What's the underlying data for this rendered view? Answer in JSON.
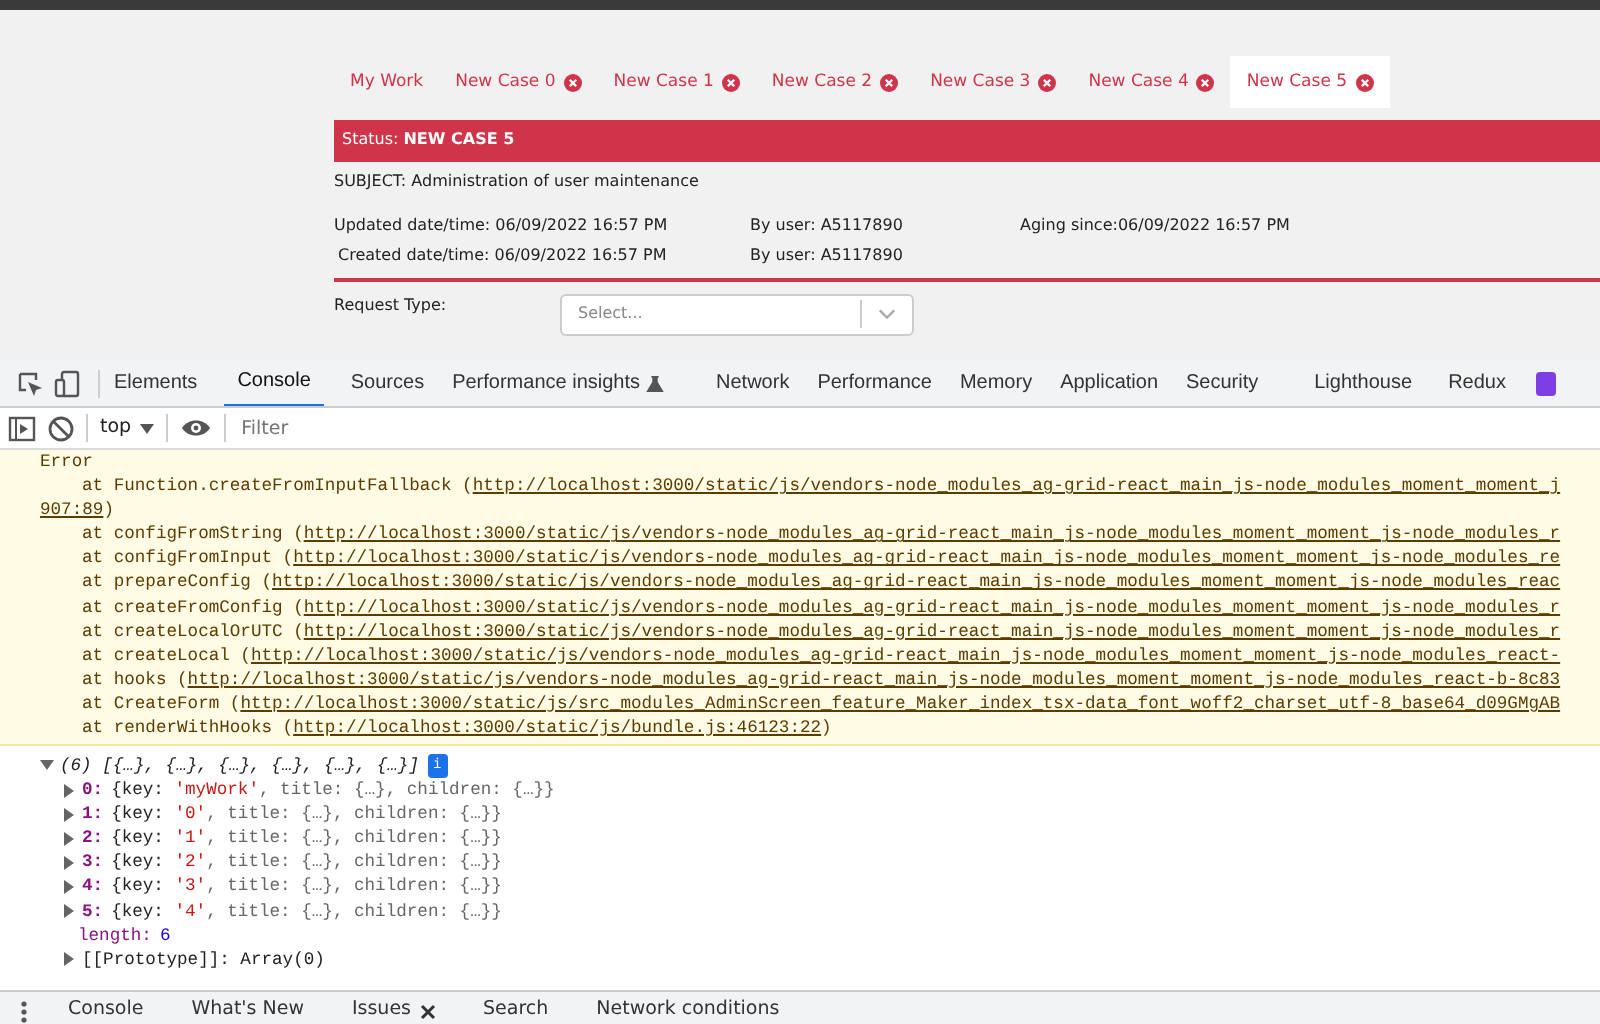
{
  "app": {
    "tabs": [
      {
        "label": "My Work",
        "closable": false,
        "selected": false
      },
      {
        "label": "New Case 0",
        "closable": true,
        "selected": false
      },
      {
        "label": "New Case 1",
        "closable": true,
        "selected": false
      },
      {
        "label": "New Case 2",
        "closable": true,
        "selected": false
      },
      {
        "label": "New Case 3",
        "closable": true,
        "selected": false
      },
      {
        "label": "New Case 4",
        "closable": true,
        "selected": false
      },
      {
        "label": "New Case 5",
        "closable": true,
        "selected": true
      }
    ],
    "status_label": "Status:",
    "status_value": "NEW CASE 5",
    "subject": "SUBJECT: Administration of user maintenance",
    "info_rows": [
      [
        "Updated date/time: 06/09/2022 16:57 PM",
        "By user: A5117890",
        "Aging since:06/09/2022 16:57 PM"
      ],
      [
        "Created date/time: 06/09/2022 16:57 PM",
        "By user: A5117890"
      ]
    ],
    "request_type_label": "Request Type:",
    "request_type_placeholder": "Select..."
  },
  "devtools": {
    "tabs": [
      {
        "label": "Elements",
        "selected": false,
        "experimental": false
      },
      {
        "label": "Console",
        "selected": true,
        "experimental": false
      },
      {
        "label": "Sources",
        "selected": false,
        "experimental": false
      },
      {
        "label": "Performance insights",
        "selected": false,
        "experimental": true
      },
      {
        "label": "Network",
        "selected": false,
        "experimental": false
      },
      {
        "label": "Performance",
        "selected": false,
        "experimental": false
      },
      {
        "label": "Memory",
        "selected": false,
        "experimental": false
      },
      {
        "label": "Application",
        "selected": false,
        "experimental": false
      },
      {
        "label": "Security",
        "selected": false,
        "experimental": false
      },
      {
        "label": "Lighthouse",
        "selected": false,
        "experimental": false
      },
      {
        "label": "Redux",
        "selected": false,
        "experimental": false
      }
    ],
    "context": "top",
    "filter_placeholder": "Filter",
    "error": {
      "title": "Error",
      "stack": [
        {
          "prefix": "at Function.createFromInputFallback (",
          "link": "http://localhost:3000/static/js/vendors-node_modules_ag-grid-react_main_js-node_modules_moment_moment_j",
          "link_cont": "907:89",
          "suffix": ")"
        },
        {
          "prefix": "at configFromString (",
          "link": "http://localhost:3000/static/js/vendors-node_modules_ag-grid-react_main_js-node_modules_moment_moment_js-node_modules_r"
        },
        {
          "prefix": "at configFromInput (",
          "link": "http://localhost:3000/static/js/vendors-node_modules_ag-grid-react_main_js-node_modules_moment_moment_js-node_modules_re"
        },
        {
          "prefix": "at prepareConfig (",
          "link": "http://localhost:3000/static/js/vendors-node_modules_ag-grid-react_main_js-node_modules_moment_moment_js-node_modules_reac"
        },
        {
          "prefix": "at createFromConfig (",
          "link": "http://localhost:3000/static/js/vendors-node_modules_ag-grid-react_main_js-node_modules_moment_moment_js-node_modules_r"
        },
        {
          "prefix": "at createLocalOrUTC (",
          "link": "http://localhost:3000/static/js/vendors-node_modules_ag-grid-react_main_js-node_modules_moment_moment_js-node_modules_r"
        },
        {
          "prefix": "at createLocal (",
          "link": "http://localhost:3000/static/js/vendors-node_modules_ag-grid-react_main_js-node_modules_moment_moment_js-node_modules_react-"
        },
        {
          "prefix": "at hooks (",
          "link": "http://localhost:3000/static/js/vendors-node_modules_ag-grid-react_main_js-node_modules_moment_moment_js-node_modules_react-b-8c83"
        },
        {
          "prefix": "at CreateForm (",
          "link": "http://localhost:3000/static/js/src_modules_AdminScreen_feature_Maker_index_tsx-data_font_woff2_charset_utf-8_base64_d09GMgAB"
        },
        {
          "prefix": "at renderWithHooks (",
          "link": "http://localhost:3000/static/js/bundle.js:46123:22",
          "suffix": ")"
        }
      ]
    },
    "array": {
      "summary": "(6) [{…}, {…}, {…}, {…}, {…}, {…}]",
      "badge": "i",
      "expanded": true,
      "items": [
        {
          "index": "0:",
          "pre": "{key: ",
          "str": "'myWork'",
          "post": ", title: {…}, children: {…}}"
        },
        {
          "index": "1:",
          "pre": "{key: ",
          "str": "'0'",
          "post": ", title: {…}, children: {…}}"
        },
        {
          "index": "2:",
          "pre": "{key: ",
          "str": "'1'",
          "post": ", title: {…}, children: {…}}"
        },
        {
          "index": "3:",
          "pre": "{key: ",
          "str": "'2'",
          "post": ", title: {…}, children: {…}}"
        },
        {
          "index": "4:",
          "pre": "{key: ",
          "str": "'3'",
          "post": ", title: {…}, children: {…}}"
        },
        {
          "index": "5:",
          "pre": "{key: ",
          "str": "'4'",
          "post": ", title: {…}, children: {…}}"
        }
      ],
      "length_label": "length:",
      "length_value": "6",
      "prototype": "[[Prototype]]: Array(0)"
    },
    "drawer_tabs": [
      {
        "label": "Console",
        "closable": false,
        "selected": false
      },
      {
        "label": "What's New",
        "closable": false,
        "selected": false
      },
      {
        "label": "Issues",
        "closable": true,
        "selected": false
      },
      {
        "label": "Search",
        "closable": false,
        "selected": false
      },
      {
        "label": "Network conditions",
        "closable": false,
        "selected": false
      }
    ]
  }
}
